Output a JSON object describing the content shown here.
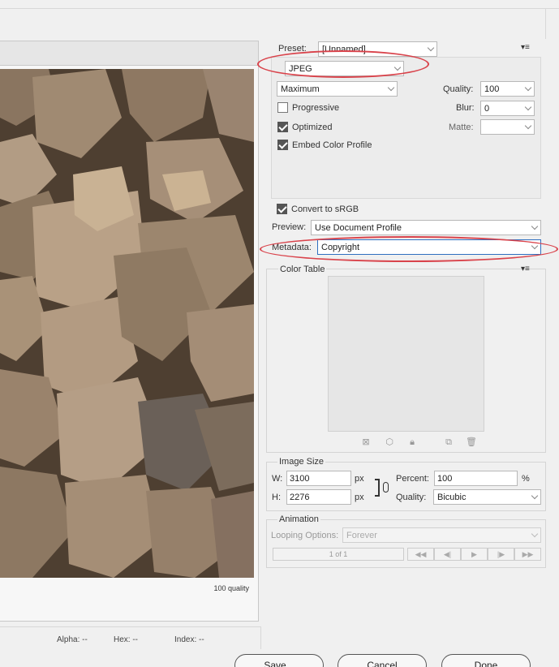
{
  "preview": {
    "quality_label": "100 quality",
    "status": {
      "alpha": "Alpha: --",
      "hex": "Hex: --",
      "index": "Index: --"
    }
  },
  "settings": {
    "preset_label": "Preset:",
    "preset_value": "[Unnamed]",
    "format_value": "JPEG",
    "compression_value": "Maximum",
    "quality_label": "Quality:",
    "quality_value": "100",
    "progressive_label": "Progressive",
    "progressive_checked": false,
    "blur_label": "Blur:",
    "blur_value": "0",
    "optimized_label": "Optimized",
    "optimized_checked": true,
    "matte_label": "Matte:",
    "matte_value": "",
    "embed_profile_label": "Embed Color Profile",
    "embed_profile_checked": true,
    "convert_srgb_label": "Convert to sRGB",
    "convert_srgb_checked": true,
    "preview_label": "Preview:",
    "preview_value": "Use Document Profile",
    "metadata_label": "Metadata:",
    "metadata_value": "Copyright"
  },
  "color_table": {
    "title": "Color Table"
  },
  "image_size": {
    "title": "Image Size",
    "w_label": "W:",
    "w_value": "3100",
    "w_unit": "px",
    "h_label": "H:",
    "h_value": "2276",
    "h_unit": "px",
    "percent_label": "Percent:",
    "percent_value": "100",
    "percent_unit": "%",
    "quality_label": "Quality:",
    "quality_value": "Bicubic"
  },
  "animation": {
    "title": "Animation",
    "looping_label": "Looping Options:",
    "looping_value": "Forever",
    "frame_counter": "1 of 1",
    "transport": [
      "◀◀",
      "◀|",
      "▶",
      "|▶",
      "▶▶"
    ]
  },
  "buttons": {
    "save": "Save...",
    "cancel": "Cancel",
    "done": "Done"
  },
  "colors": {
    "highlight": "#d9434b",
    "accent_border": "#2f6fc0"
  }
}
